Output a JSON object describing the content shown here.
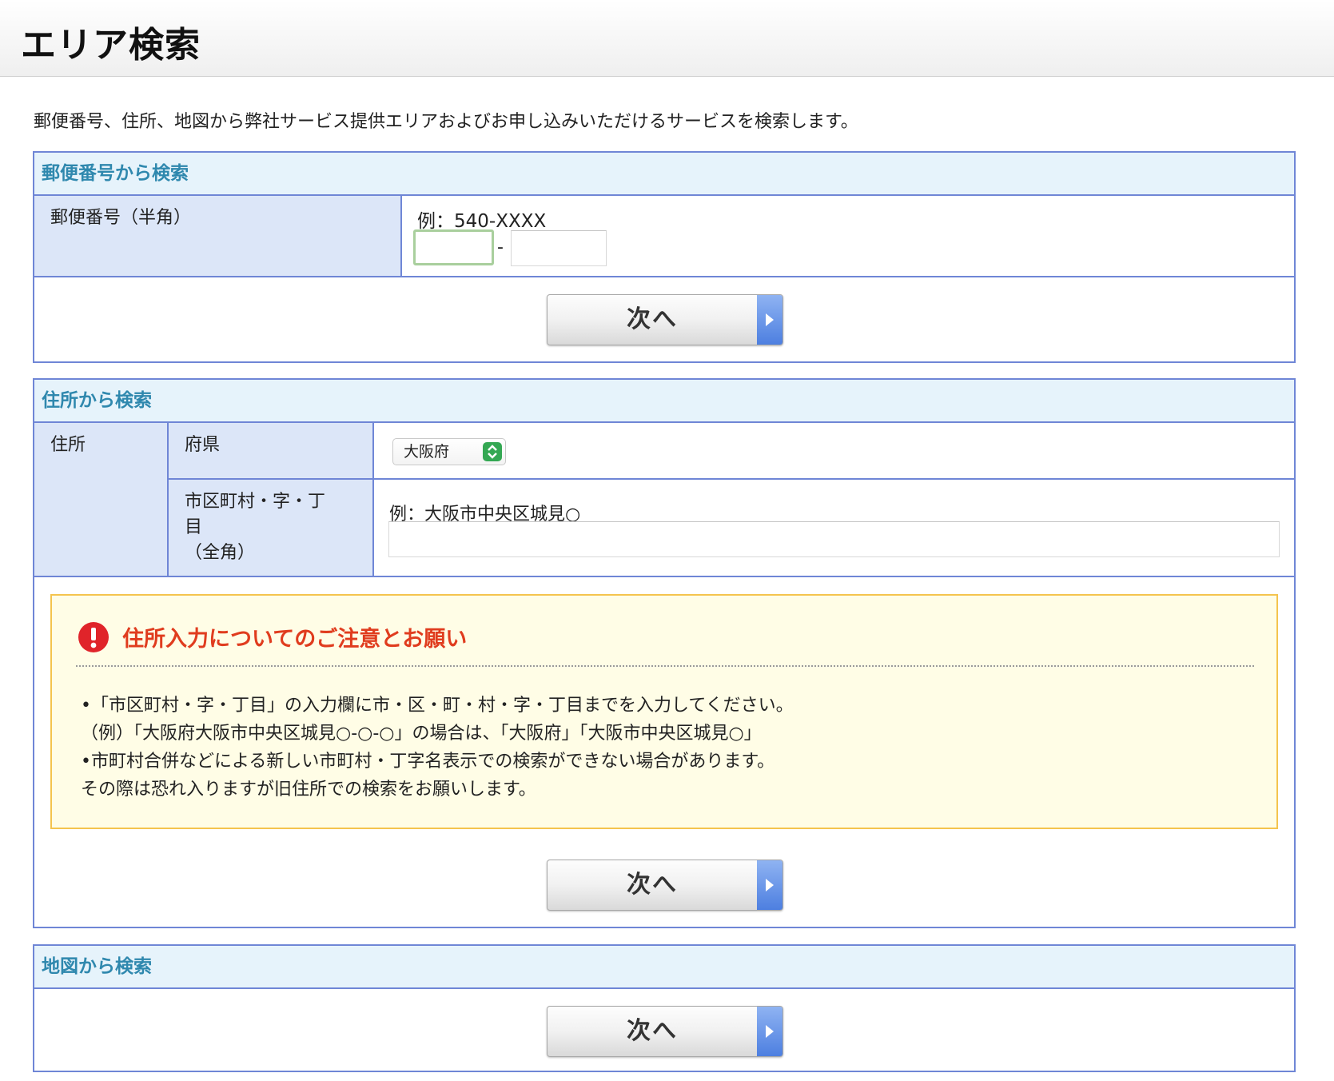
{
  "header": {
    "title": "エリア検索"
  },
  "intro": "郵便番号、住所、地図から弊社サービス提供エリアおよびお申し込みいただけるサービスを検索します。",
  "postal_section": {
    "title": "郵便番号から検索",
    "label": "郵便番号（半角）",
    "example": "例：540-XXXX",
    "part1_value": "",
    "part2_value": "",
    "separator": "-",
    "next_label": "次へ"
  },
  "address_section": {
    "title": "住所から検索",
    "label": "住所",
    "prefecture_label": "府県",
    "prefecture_value": "大阪府",
    "city_label_line1": "市区町村・字・丁",
    "city_label_line2": "目",
    "city_label_line3": "（全角）",
    "city_example": "例：大阪市中央区城見○",
    "city_value": "",
    "next_label": "次へ"
  },
  "notice": {
    "icon": "exclamation-icon",
    "title": "住所入力についてのご注意とお願い",
    "lines": [
      "•「市区町村・字・丁目」の入力欄に市・区・町・村・字・丁目までを入力してください。",
      "（例）「大阪府大阪市中央区城見○-○-○」の場合は、「大阪府」「大阪市中央区城見○」",
      "•市町村合併などによる新しい市町村・丁字名表示での検索ができない場合があります。",
      "その際は恐れ入りますが旧住所での検索をお願いします。"
    ]
  },
  "map_section": {
    "title": "地図から検索",
    "next_label": "次へ"
  },
  "colors": {
    "section_border": "#6f86d6",
    "section_header_bg": "#e6f3fb",
    "section_title": "#2f88ae",
    "label_bg": "#dce6f8",
    "notice_bg": "#fffde6",
    "notice_border": "#f4c44e",
    "notice_title": "#e03c1e",
    "button_arrow": "#4d7fe0"
  }
}
